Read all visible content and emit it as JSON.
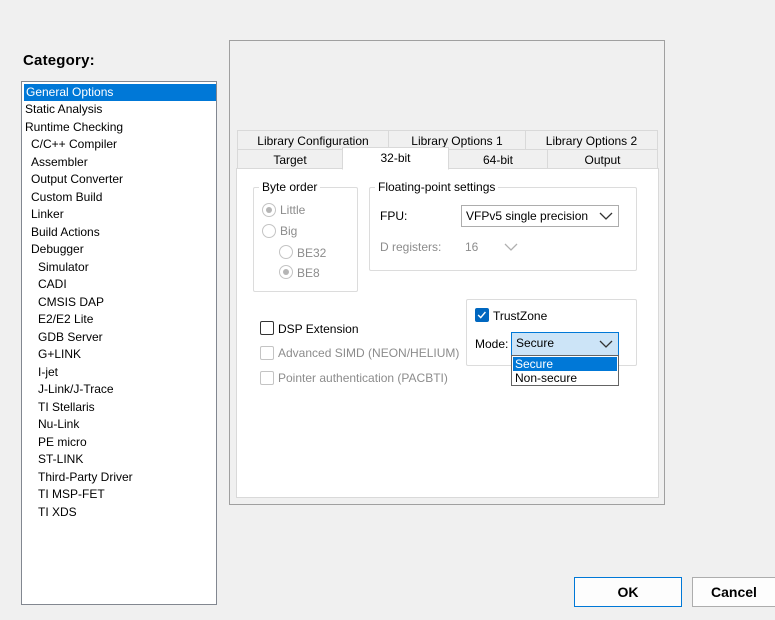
{
  "category": {
    "label": "Category:",
    "items": [
      {
        "label": "General Options",
        "selected": true
      },
      {
        "label": "Static Analysis"
      },
      {
        "label": "Runtime Checking"
      },
      {
        "label": "C/C++ Compiler"
      },
      {
        "label": "Assembler"
      },
      {
        "label": "Output Converter"
      },
      {
        "label": "Custom Build"
      },
      {
        "label": "Linker"
      },
      {
        "label": "Build Actions"
      },
      {
        "label": "Debugger"
      },
      {
        "label": "Simulator"
      },
      {
        "label": "CADI"
      },
      {
        "label": "CMSIS DAP"
      },
      {
        "label": "E2/E2 Lite"
      },
      {
        "label": "GDB Server"
      },
      {
        "label": "G+LINK"
      },
      {
        "label": "I-jet"
      },
      {
        "label": "J-Link/J-Trace"
      },
      {
        "label": "TI Stellaris"
      },
      {
        "label": "Nu-Link"
      },
      {
        "label": "PE micro"
      },
      {
        "label": "ST-LINK"
      },
      {
        "label": "Third-Party Driver"
      },
      {
        "label": "TI MSP-FET"
      },
      {
        "label": "TI XDS"
      }
    ]
  },
  "tabs": {
    "row1": [
      "Library Configuration",
      "Library Options 1",
      "Library Options 2"
    ],
    "row2": [
      "Target",
      "32-bit",
      "64-bit",
      "Output"
    ],
    "active": "32-bit"
  },
  "byte_order": {
    "title": "Byte order",
    "little": "Little",
    "big": "Big",
    "be32": "BE32",
    "be8": "BE8",
    "selected": "Little",
    "big_selected": "BE8"
  },
  "fp": {
    "title": "Floating-point settings",
    "fpu_label": "FPU:",
    "fpu_value": "VFPv5 single precision",
    "dreg_label": "D registers:",
    "dreg_value": "16"
  },
  "options": {
    "dsp": "DSP Extension",
    "simd": "Advanced SIMD (NEON/HELIUM)",
    "pacbti": "Pointer authentication (PACBTI)"
  },
  "trustzone": {
    "label": "TrustZone",
    "checked": true,
    "mode_label": "Mode:",
    "mode_value": "Secure",
    "options": [
      "Secure",
      "Non-secure"
    ]
  },
  "buttons": {
    "ok": "OK",
    "cancel": "Cancel"
  },
  "colors": {
    "accent": "#0078d7"
  }
}
